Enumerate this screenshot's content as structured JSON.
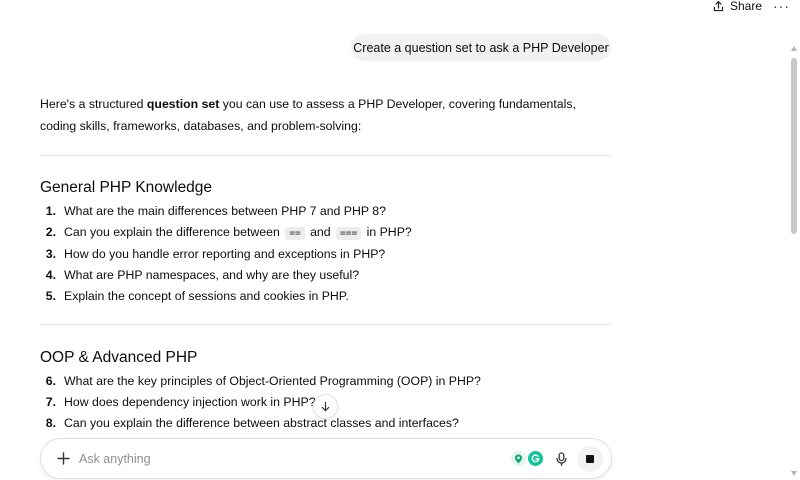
{
  "header": {
    "share_label": "Share",
    "more_label": "···"
  },
  "conversation": {
    "user_message": "Create a question set to ask a PHP Developer",
    "intro": {
      "before": "Here's a structured ",
      "bold": "question set",
      "after": " you can use to assess a PHP Developer, covering fundamentals, coding skills, frameworks, databases, and problem-solving:"
    },
    "sections": [
      {
        "title": "General PHP Knowledge",
        "questions": [
          {
            "num": "1.",
            "text": "What are the main differences between PHP 7 and PHP 8?"
          },
          {
            "num": "2.",
            "pre": "Can you explain the difference between ",
            "code1": "==",
            "mid": " and ",
            "code2": "===",
            "post": " in PHP?"
          },
          {
            "num": "3.",
            "text": "How do you handle error reporting and exceptions in PHP?"
          },
          {
            "num": "4.",
            "text": "What are PHP namespaces, and why are they useful?"
          },
          {
            "num": "5.",
            "text": "Explain the concept of sessions and cookies in PHP."
          }
        ]
      },
      {
        "title": "OOP & Advanced PHP",
        "questions": [
          {
            "num": "6.",
            "text": "What are the key principles of Object-Oriented Programming (OOP) in PHP?"
          },
          {
            "num": "7.",
            "text": "How does dependency injection work in PHP?"
          },
          {
            "num": "8.",
            "text": "Can you explain the difference between abstract classes and interfaces?"
          }
        ]
      }
    ]
  },
  "composer": {
    "placeholder": "Ask anything"
  },
  "icons": {
    "share": "share-icon",
    "more": "more-icon",
    "scroll_down": "arrow-down-icon",
    "plus": "plus-icon",
    "mic": "microphone-icon",
    "stop": "stop-icon"
  },
  "colors": {
    "user_bubble": "#f1f1f1",
    "grammarly_green": "#15c39a",
    "divider": "#e5e5e5"
  }
}
